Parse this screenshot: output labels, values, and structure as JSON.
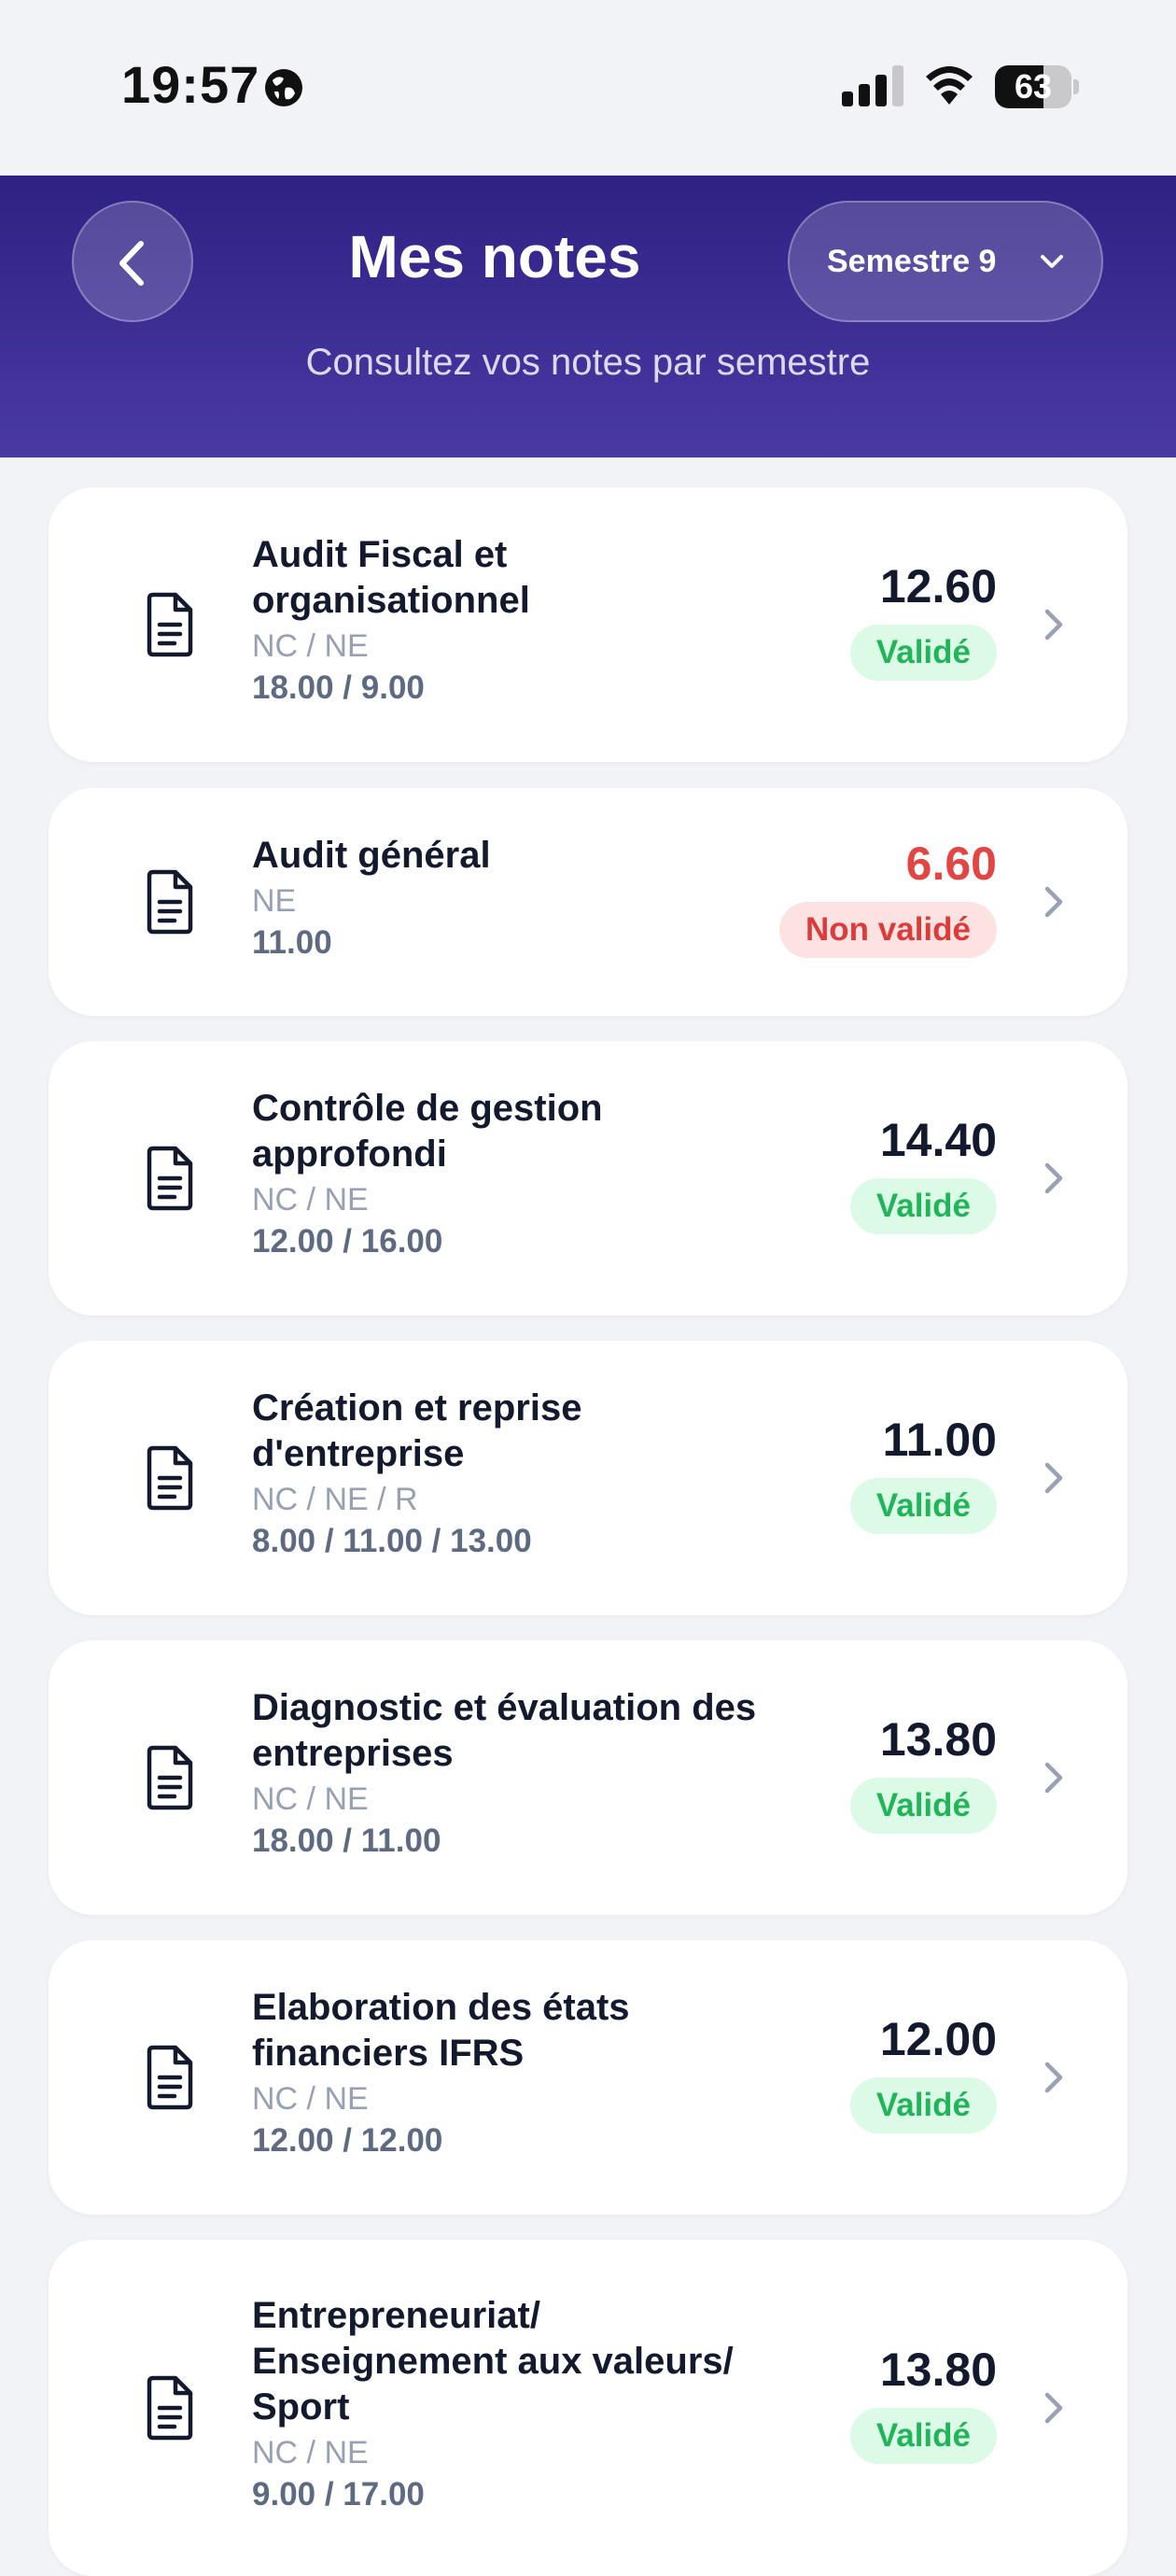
{
  "status_bar": {
    "time": "19:57",
    "battery": "63",
    "battery_level": 0.63
  },
  "header": {
    "title": "Mes notes",
    "subtitle": "Consultez vos notes par semestre",
    "semester": "Semestre 9"
  },
  "modules": [
    {
      "title_lines": [
        "Audit Fiscal et",
        "organisationnel"
      ],
      "types": "NC / NE",
      "scores": "18.00 / 9.00",
      "average": "12.60",
      "status": "Validé",
      "valid": true
    },
    {
      "title_lines": [
        "Audit général"
      ],
      "types": "NE",
      "scores": "11.00",
      "average": "6.60",
      "status": "Non validé",
      "valid": false
    },
    {
      "title_lines": [
        "Contrôle de gestion",
        "approfondi"
      ],
      "types": "NC / NE",
      "scores": "12.00 / 16.00",
      "average": "14.40",
      "status": "Validé",
      "valid": true
    },
    {
      "title_lines": [
        "Création et reprise",
        "d'entreprise"
      ],
      "types": "NC / NE / R",
      "scores": "8.00 / 11.00 / 13.00",
      "average": "11.00",
      "status": "Validé",
      "valid": true
    },
    {
      "title_lines": [
        "Diagnostic et évaluation des",
        "entreprises"
      ],
      "types": "NC / NE",
      "scores": "18.00 / 11.00",
      "average": "13.80",
      "status": "Validé",
      "valid": true
    },
    {
      "title_lines": [
        "Elaboration des états",
        "financiers IFRS"
      ],
      "types": "NC / NE",
      "scores": "12.00 / 12.00",
      "average": "12.00",
      "status": "Validé",
      "valid": true
    },
    {
      "title_lines": [
        "Entrepreneuriat/",
        "Enseignement aux valeurs/",
        "Sport"
      ],
      "types": "NC / NE",
      "scores": "9.00 / 17.00",
      "average": "13.80",
      "status": "Validé",
      "valid": true
    }
  ]
}
